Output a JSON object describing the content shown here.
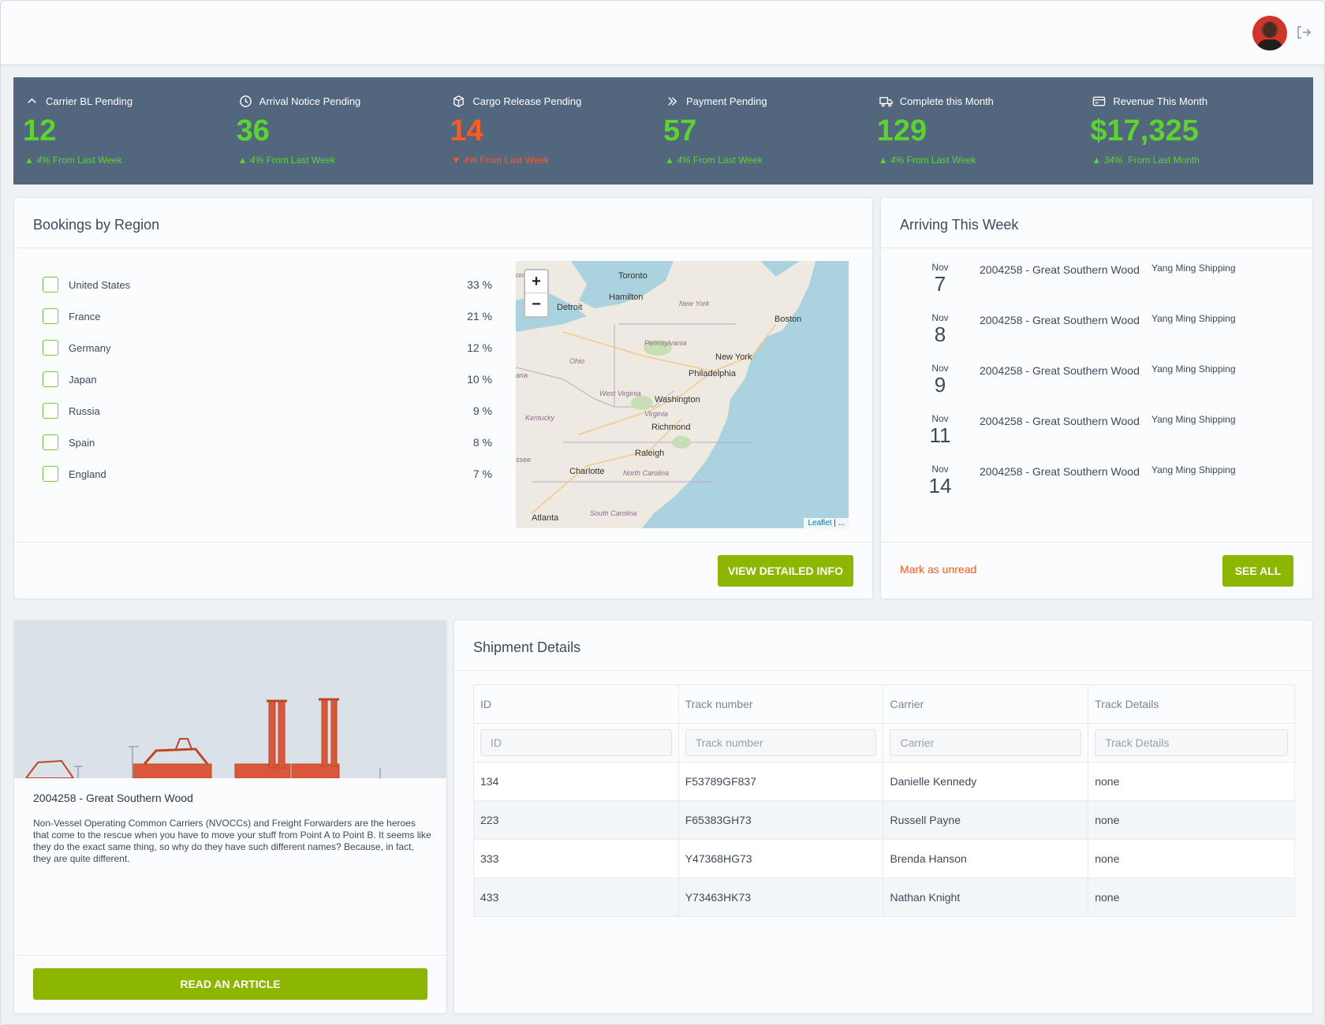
{
  "stats": [
    {
      "label": "Carrier BL Pending",
      "icon": "chevron-up-icon",
      "value": "12",
      "trend_dir": "up",
      "trend_pct": "4%",
      "trend_text": "From Last Week"
    },
    {
      "label": "Arrival Notice Pending",
      "icon": "clock-icon",
      "value": "36",
      "trend_dir": "up",
      "trend_pct": "4%",
      "trend_text": "From Last Week"
    },
    {
      "label": "Cargo Release Pending",
      "icon": "box-icon",
      "value": "14",
      "trend_dir": "down",
      "trend_pct": "4%",
      "trend_text": "From Last Week"
    },
    {
      "label": "Payment Pending",
      "icon": "double-chevron-right-icon",
      "value": "57",
      "trend_dir": "up",
      "trend_pct": "4%",
      "trend_text": "From Last Week"
    },
    {
      "label": "Complete this Month",
      "icon": "truck-icon",
      "value": "129",
      "trend_dir": "up",
      "trend_pct": "4%",
      "trend_text": "From Last Week"
    },
    {
      "label": "Revenue This Month",
      "icon": "credit-card-icon",
      "value": "$17,325",
      "trend_dir": "up",
      "trend_pct": "34%",
      "trend_text": "From Last Month"
    }
  ],
  "colors": {
    "up": "#5bd42f",
    "down": "#ff5a1f",
    "accent": "#8db600",
    "stats_bg": "#52667e"
  },
  "bookings": {
    "title": "Bookings by Region",
    "regions": [
      {
        "name": "United States",
        "pct": "33 %"
      },
      {
        "name": "France",
        "pct": "21 %"
      },
      {
        "name": "Germany",
        "pct": "12 %"
      },
      {
        "name": "Japan",
        "pct": "10 %"
      },
      {
        "name": "Russia",
        "pct": "9 %"
      },
      {
        "name": "Spain",
        "pct": "8 %"
      },
      {
        "name": "England",
        "pct": "7 %"
      }
    ],
    "map": {
      "zoom_in": "+",
      "zoom_out": "−",
      "attribution_link": "Leaflet",
      "attribution_rest": " | ...",
      "labels": {
        "toronto": "Toronto",
        "hamilton": "Hamilton",
        "detroit": "Detroit",
        "new_york_state": "New York",
        "boston": "Boston",
        "pennsylvania": "Pennsylvania",
        "ohio": "Ohio",
        "new_york": "New York",
        "philadelphia": "Philadelphia",
        "west_virginia": "West Virginia",
        "washington": "Washington",
        "virginia": "Virginia",
        "kentucky": "Kentucky",
        "richmond": "Richmond",
        "raleigh": "Raleigh",
        "charlotte": "Charlotte",
        "north_carolina": "North Carolina",
        "south_carolina": "South Carolina",
        "atlanta": "Atlanta",
        "edge_on": "on",
        "edge_ana": "ana",
        "edge_ssee": "ssee"
      }
    },
    "button": "VIEW DETAILED INFO"
  },
  "arriving": {
    "title": "Arriving This Week",
    "items": [
      {
        "month": "Nov",
        "day": "7",
        "title": "2004258 - Great Southern Wood",
        "carrier": "Yang Ming Shipping"
      },
      {
        "month": "Nov",
        "day": "8",
        "title": "2004258 - Great Southern Wood",
        "carrier": "Yang Ming Shipping"
      },
      {
        "month": "Nov",
        "day": "9",
        "title": "2004258 - Great Southern Wood",
        "carrier": "Yang Ming Shipping"
      },
      {
        "month": "Nov",
        "day": "11",
        "title": "2004258 - Great Southern Wood",
        "carrier": "Yang Ming Shipping"
      },
      {
        "month": "Nov",
        "day": "14",
        "title": "2004258 - Great Southern Wood",
        "carrier": "Yang Ming Shipping"
      }
    ],
    "mark_unread": "Mark as unread",
    "button": "SEE ALL"
  },
  "article": {
    "title": "2004258 - Great Southern Wood",
    "body": "Non-Vessel Operating Common Carriers (NVOCCs) and Freight Forwarders are the heroes that come to the rescue when you have to move your stuff from Point A to Point B. It seems like they do the exact same thing, so why do they have such different names? Because, in fact, they are quite different.",
    "button": "READ AN ARTICLE"
  },
  "shipment": {
    "title": "Shipment Details",
    "columns": [
      "ID",
      "Track number",
      "Carrier",
      "Track Details"
    ],
    "filters": [
      "ID",
      "Track number",
      "Carrier",
      "Track Details"
    ],
    "rows": [
      [
        "134",
        "F53789GF837",
        "Danielle Kennedy",
        "none"
      ],
      [
        "223",
        "F65383GH73",
        "Russell Payne",
        "none"
      ],
      [
        "333",
        "Y47368HG73",
        "Brenda Hanson",
        "none"
      ],
      [
        "433",
        "Y73463HK73",
        "Nathan Knight",
        "none"
      ]
    ]
  }
}
